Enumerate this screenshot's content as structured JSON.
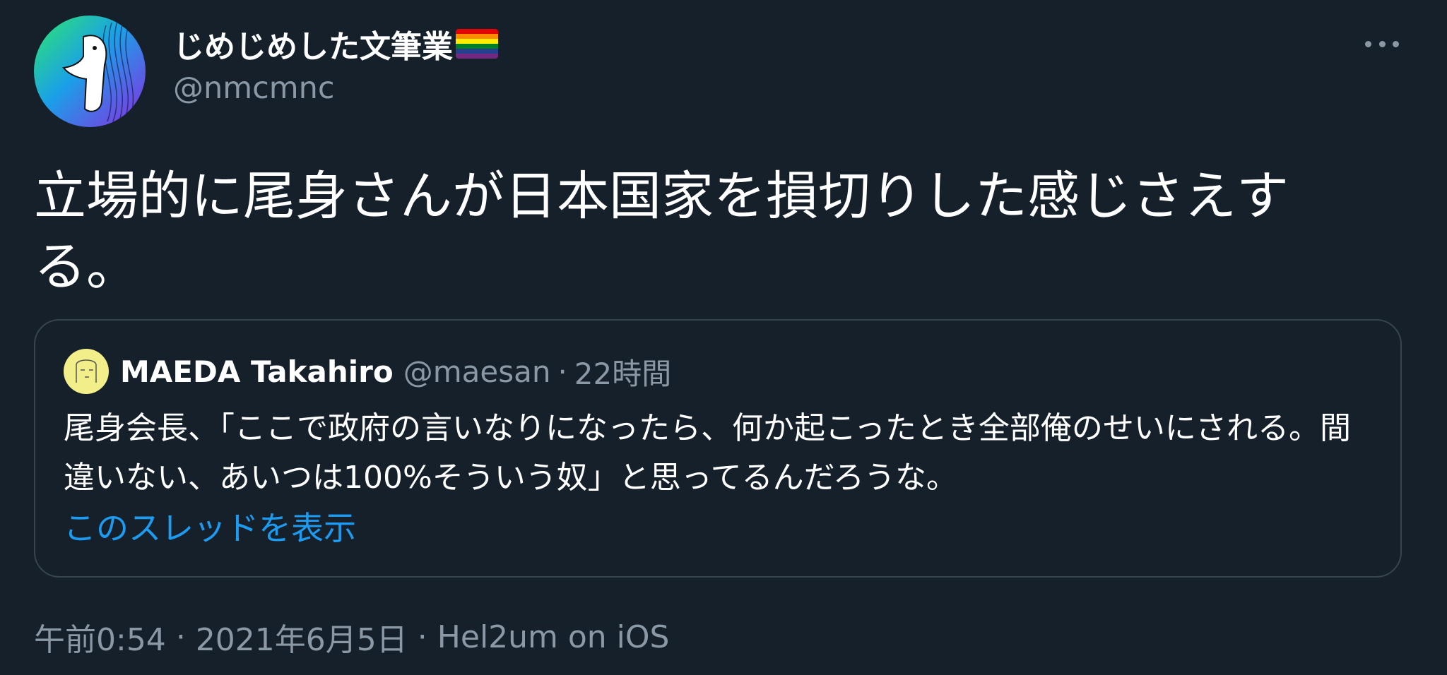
{
  "author": {
    "display_name": "じめじめした文筆業",
    "handle": "@nmcmnc",
    "flag_icon": "rainbow-flag-icon",
    "flag_colors": [
      "#e40303",
      "#ff8c00",
      "#ffed00",
      "#008026",
      "#24408e",
      "#732982"
    ]
  },
  "more_icon": "more-horizontal-icon",
  "tweet": {
    "text": "立場的に尾身さんが日本国家を損切りした感じさえする。"
  },
  "quoted": {
    "display_name": "MAEDA Takahiro",
    "handle": "@maesan",
    "separator": "·",
    "time": "22時間",
    "text": "尾身会長、「ここで政府の言いなりになったら、何か起こったとき全部俺のせいにされる。間違いない、あいつは100%そういう奴」と思ってるんだろうな。",
    "thread_link": "このスレッドを表示"
  },
  "meta": {
    "time": "午前0:54",
    "separator1": "·",
    "date": "2021年6月5日",
    "separator2": "·",
    "source": "Hel2um on iOS"
  },
  "colors": {
    "background": "#15202b",
    "secondary_text": "#8b98a5",
    "link": "#1d9bf0",
    "border": "#38444d"
  }
}
